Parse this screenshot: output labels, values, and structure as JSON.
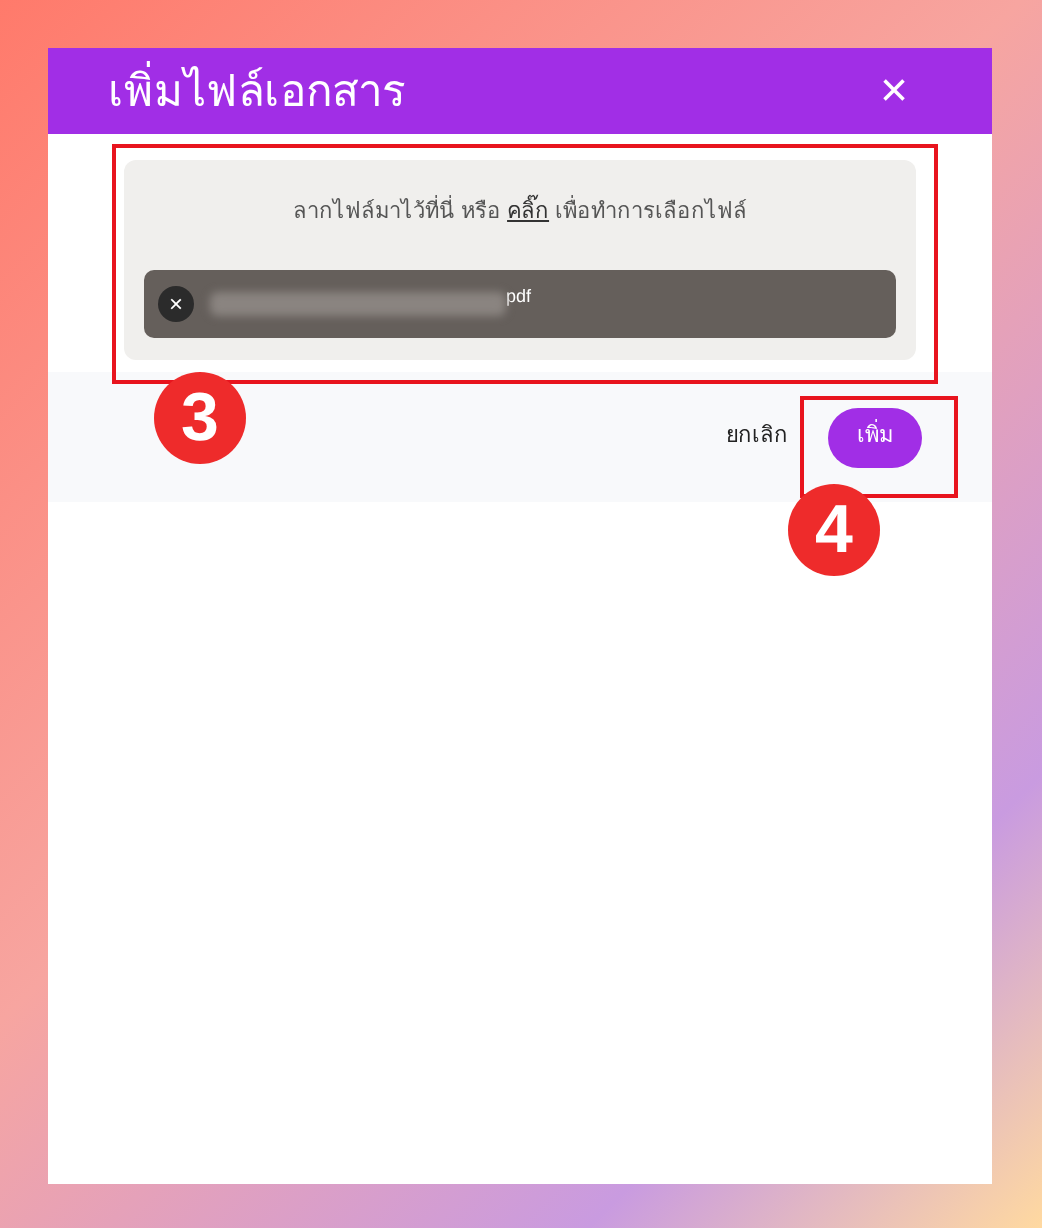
{
  "dialog": {
    "title": "เพิ่มไฟล์เอกสาร",
    "close": "×"
  },
  "dropzone": {
    "hint_before": "ลากไฟล์มาไว้ที่นี่ หรือ ",
    "link": "คลิ๊ก",
    "hint_after": " เพื่อทำการเลือกไฟล์",
    "file": {
      "remove": "×",
      "extension": "pdf"
    }
  },
  "footer": {
    "cancel": "ยกเลิก",
    "submit": "เพิ่ม"
  },
  "callouts": [
    {
      "number": "3"
    },
    {
      "number": "4"
    }
  ]
}
